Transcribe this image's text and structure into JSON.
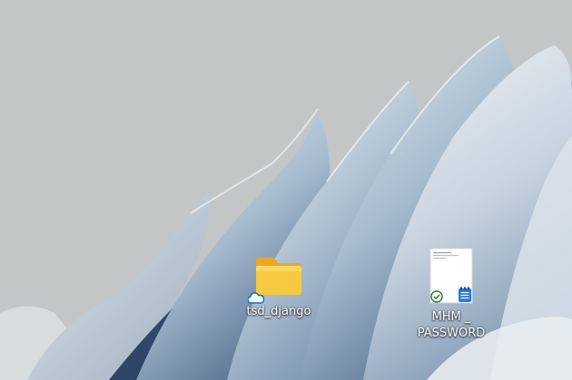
{
  "desktop": {
    "icons": [
      {
        "label": "tsd_django",
        "icon": "folder-icon",
        "sync_status": "cloud-icon"
      },
      {
        "label": "MHM _\nPASSWORD",
        "icon": "text-document-icon",
        "sync_status": "synced-check-icon",
        "app_badge": "notepad-icon"
      }
    ]
  },
  "colors": {
    "folder": "#f7c940",
    "folder_dark": "#e9a820",
    "onedrive_cloud": "#0f6cbd",
    "synced_check": "#1b7d3c",
    "notepad_badge": "#2b79d8"
  }
}
